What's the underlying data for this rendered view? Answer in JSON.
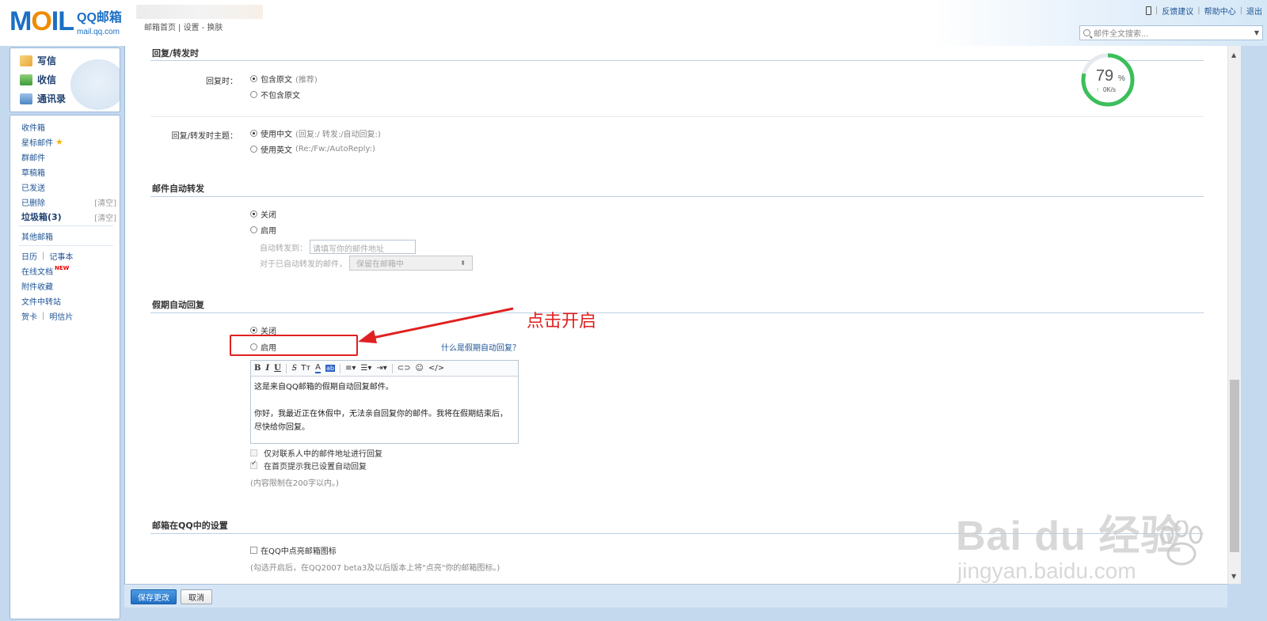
{
  "header": {
    "logo_text": "MOIL",
    "brand": "QQ邮箱",
    "domain": "mail.qq.com",
    "nav": [
      "邮箱首页",
      "设置",
      "换肤"
    ],
    "right_links": [
      "反馈建议",
      "帮助中心",
      "退出"
    ],
    "search_placeholder": "邮件全文搜索..."
  },
  "sidebar": {
    "quick": [
      "写信",
      "收信",
      "通讯录"
    ],
    "folders": [
      {
        "label": "收件箱"
      },
      {
        "label": "星标邮件"
      },
      {
        "label": "群邮件"
      },
      {
        "label": "草稿箱"
      },
      {
        "label": "已发送"
      },
      {
        "label": "已删除",
        "action": "[清空]"
      },
      {
        "label": "垃圾箱(3)",
        "action": "[清空]"
      }
    ],
    "other_mailbox": "其他邮箱",
    "calendar": "日历",
    "notes": "记事本",
    "online_docs": "在线文档",
    "new_badge": "NEW",
    "attachments": "附件收藏",
    "file_transfer": "文件中转站",
    "cards": "贺卡",
    "postcards": "明信片"
  },
  "settings": {
    "reply_section_title": "回复/转发时",
    "reply_label": "回复时：",
    "reply_opt1": "包含原文",
    "reply_opt1_hint": "(推荐)",
    "reply_opt2": "不包含原文",
    "subject_label": "回复/转发时主题：",
    "subject_opt1": "使用中文",
    "subject_opt1_hint": "(回复:/ 转发:/自动回复:)",
    "subject_opt2": "使用英文",
    "subject_opt2_hint": "(Re:/Fw:/AutoReply:)",
    "forward_title": "邮件自动转发",
    "forward_off": "关闭",
    "forward_on": "启用",
    "forward_to_label": "自动转发到：",
    "forward_to_placeholder": "请填写你的邮件地址",
    "forwarded_label": "对于已自动转发的邮件，",
    "forwarded_select": "保留在邮箱中",
    "vacation_title": "假期自动回复",
    "vacation_off": "关闭",
    "vacation_on": "启用",
    "vacation_help": "什么是假期自动回复？",
    "editor_line1": "这是来自QQ邮箱的假期自动回复邮件。",
    "editor_line2": "你好，我最近正在休假中，无法亲自回复你的邮件。我将在假期结束后，尽快给你回复。",
    "contacts_only": "仅对联系人中的邮件地址进行回复",
    "homepage_notice": "在首页提示我已设置自动回复",
    "limit_note": "(内容限制在200字以内。)",
    "qq_title": "邮箱在QQ中的设置",
    "qq_light": "在QQ中点亮邮箱图标",
    "qq_note": "(勾选开启后，在QQ2007 beta3及以后版本上将\"点亮\"你的邮箱图标。)"
  },
  "annotation": {
    "callout": "点击开启"
  },
  "speed_widget": {
    "percent": "79",
    "unit": "%",
    "rate": "0K/s",
    "progress": 0.79
  },
  "footer": {
    "save": "保存更改",
    "cancel": "取消"
  },
  "watermark": {
    "brand": "Bai du 经验",
    "url": "jingyan.baidu.com"
  },
  "colors": {
    "accent": "#1b6fc4",
    "frame": "#c4d8ee",
    "annotation": "#e02020",
    "progress": "#3bbf5a"
  }
}
